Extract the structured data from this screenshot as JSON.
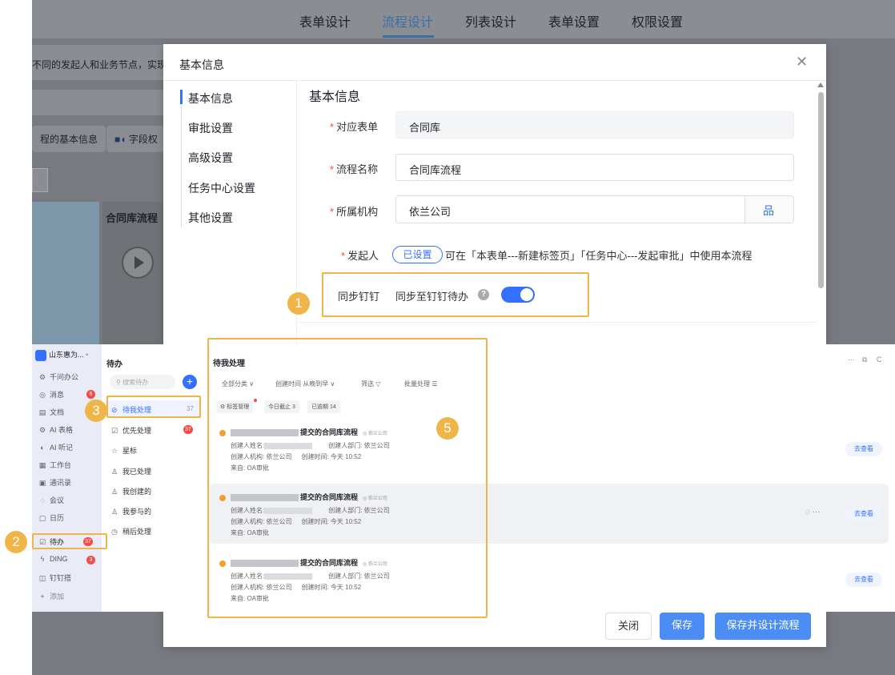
{
  "nav": {
    "tabs": [
      {
        "label": "表单设计"
      },
      {
        "label": "流程设计"
      },
      {
        "label": "列表设计"
      },
      {
        "label": "表单设置"
      },
      {
        "label": "权限设置"
      }
    ],
    "active_index": 1
  },
  "background": {
    "info_text": "不同的发起人和业务节点，实现",
    "basic_info_button": "程的基本信息",
    "field_button": "字段权",
    "card_title": "合同库流程"
  },
  "modal": {
    "title": "基本信息",
    "sidebar": [
      "基本信息",
      "审批设置",
      "高级设置",
      "任务中心设置",
      "其他设置"
    ],
    "section_title": "基本信息",
    "fields": {
      "form": {
        "label": "对应表单",
        "value": "合同库"
      },
      "flow_name": {
        "label": "流程名称",
        "value": "合同库流程"
      },
      "org": {
        "label": "所属机构",
        "value": "依兰公司"
      },
      "initiator": {
        "label": "发起人",
        "tag": "已设置",
        "desc": "可在「本表单---新建标签页」「任务中心---发起审批」中使用本流程"
      },
      "sync": {
        "label": "同步钉钉",
        "desc": "同步至钉钉待办",
        "enabled": true
      }
    },
    "buttons": {
      "close": "关闭",
      "save": "保存",
      "save_design": "保存并设计流程"
    }
  },
  "callouts": [
    "1",
    "2",
    "3",
    "5"
  ],
  "dingtalk": {
    "org_name": "山东惠为...",
    "nav": [
      {
        "icon": "⚙",
        "label": "千问办公"
      },
      {
        "icon": "◎",
        "label": "消息",
        "badge": "6"
      },
      {
        "icon": "▤",
        "label": "文档"
      },
      {
        "icon": "⚙",
        "label": "AI 表格"
      },
      {
        "icon": "◐",
        "label": "AI 听记"
      },
      {
        "icon": "▦",
        "label": "工作台"
      },
      {
        "icon": "▣",
        "label": "通讯录"
      },
      {
        "icon": "◌",
        "label": "会议"
      },
      {
        "icon": "▢",
        "label": "日历"
      },
      {
        "icon": "☑",
        "label": "待办",
        "badge": "37"
      },
      {
        "icon": "ϟ",
        "label": "DING",
        "badge": "3"
      },
      {
        "icon": "◫",
        "label": "钉钉搭"
      },
      {
        "icon": "+",
        "label": "添加"
      }
    ],
    "todo": {
      "title": "待办",
      "search_placeholder": "搜索待办",
      "plus": "+",
      "items": [
        {
          "icon": "⊘",
          "label": "待我处理",
          "count": "37"
        },
        {
          "icon": "☑",
          "label": "优先处理",
          "badge": "37"
        },
        {
          "icon": "☆",
          "label": "星标"
        },
        {
          "icon": "♙",
          "label": "我已处理"
        },
        {
          "icon": "♙",
          "label": "我创建的"
        },
        {
          "icon": "♙",
          "label": "我参与的"
        },
        {
          "icon": "◷",
          "label": "稍后处理"
        }
      ]
    },
    "main": {
      "title": "待我处理",
      "filters": [
        "全部分类 ∨",
        "创建时间 从晚到早 ∨",
        "筛选 ▽",
        "批量处理 ☰"
      ],
      "chips": [
        "⚙ 标签管理",
        "今日截止 3",
        "已逾期 14"
      ],
      "top_right_icons": [
        "···",
        "⧉",
        "C"
      ],
      "cards": [
        {
          "title_suffix": "提交的合同库流程",
          "org": "◎ 依兰公司",
          "creator_label": "创建人姓名:",
          "dept": "创建人部门: 依兰公司",
          "org_line": "创建人机构: 依兰公司",
          "time": "创建时间: 今天 10:52",
          "from": "来自: OA审批",
          "action": "去查看"
        },
        {
          "title_suffix": "提交的合同库流程",
          "org": "◎ 依兰公司",
          "creator_label": "创建人姓名:",
          "dept": "创建人部门: 依兰公司",
          "org_line": "创建人机构: 依兰公司",
          "time": "创建时间: 今天 10:52",
          "from": "来自: OA审批",
          "action": "去查看",
          "more": "◌ ···"
        },
        {
          "title_suffix": "提交的合同库流程",
          "org": "◎ 依兰公司",
          "creator_label": "创建人姓名:",
          "dept": "创建人部门: 依兰公司",
          "org_line": "创建人机构: 依兰公司",
          "time": "创建时间: 今天 10:52",
          "from": "来自: OA审批",
          "action": "去查看"
        }
      ]
    }
  }
}
